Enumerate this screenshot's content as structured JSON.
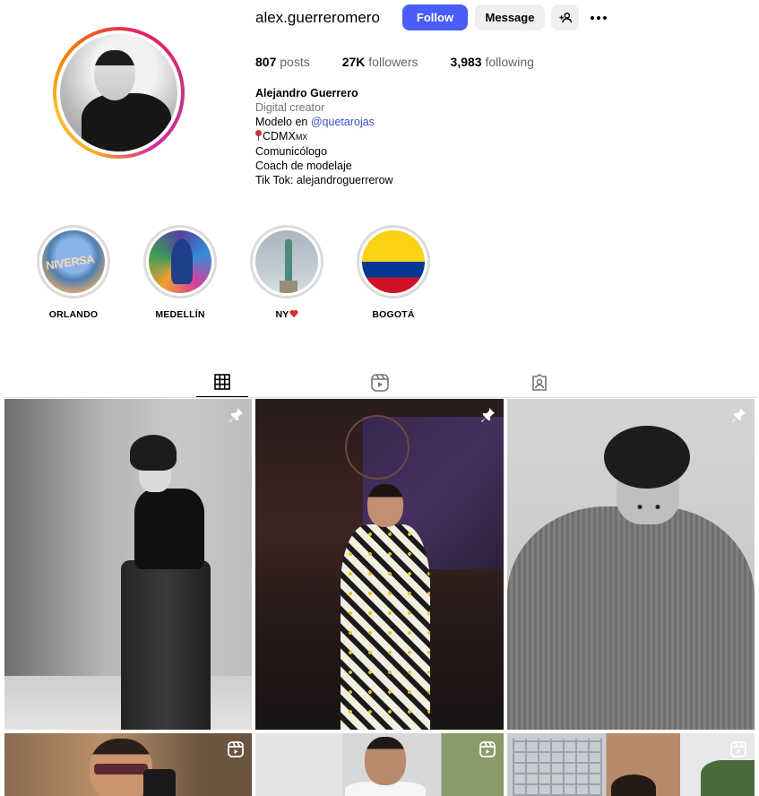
{
  "profile": {
    "username": "alex.guerreromero",
    "follow_label": "Follow",
    "message_label": "Message",
    "stats": {
      "posts_count": "807",
      "posts_label": "posts",
      "followers_count": "27K",
      "followers_label": "followers",
      "following_count": "3,983",
      "following_label": "following"
    },
    "bio": {
      "name": "Alejandro Guerrero",
      "category": "Digital creator",
      "line1_prefix": "Modelo en ",
      "line1_mention": "@quetarojas",
      "line2_text": "CDMX",
      "line2_suffix": "MX",
      "line3": "Comunicólogo",
      "line4": "Coach de modelaje",
      "line5": "Tik Tok: alejandroguerrerow"
    }
  },
  "highlights": [
    {
      "label": "ORLANDO",
      "image_text": "NIVERSA"
    },
    {
      "label": "MEDELLÍN"
    },
    {
      "label": "NY"
    },
    {
      "label": "BOGOTÁ"
    }
  ],
  "tabs": [
    "posts-grid-icon",
    "reels-icon",
    "tagged-icon"
  ],
  "posts": [
    {
      "badge": "pinned-icon"
    },
    {
      "badge": "pinned-icon"
    },
    {
      "badge": "pinned-icon"
    },
    {
      "badge": "reel-icon"
    },
    {
      "badge": "reel-icon"
    },
    {
      "badge": "reel-icon"
    }
  ],
  "colors": {
    "follow_button": "#4a5df9",
    "secondary_button": "#efefef",
    "mention_link": "#3a4fc8",
    "muted_text": "#737373"
  }
}
